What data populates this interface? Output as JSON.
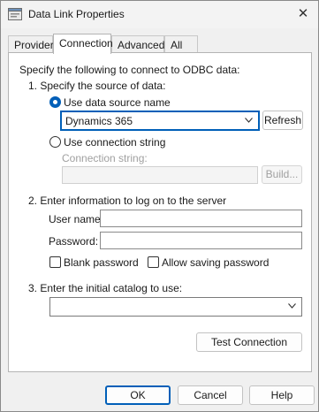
{
  "window": {
    "title": "Data Link Properties",
    "close_glyph": "✕"
  },
  "tabs": [
    {
      "label": "Provider",
      "active": false
    },
    {
      "label": "Connection",
      "active": true
    },
    {
      "label": "Advanced",
      "active": false
    },
    {
      "label": "All",
      "active": false
    }
  ],
  "connection": {
    "intro": "Specify the following to connect to ODBC data:",
    "step1": "1. Specify the source of data:",
    "use_dsn_label": "Use data source name",
    "use_dsn_selected": true,
    "dsn_value": "Dynamics 365",
    "refresh_label": "Refresh",
    "use_connstr_label": "Use connection string",
    "connstr_label": "Connection string:",
    "connstr_value": "",
    "build_label": "Build...",
    "step2": "2. Enter information to log on to the server",
    "username_label": "User name:",
    "username_value": "",
    "password_label": "Password:",
    "password_value": "",
    "blank_password_label": "Blank password",
    "blank_password_checked": false,
    "allow_saving_label": "Allow saving password",
    "allow_saving_checked": false,
    "step3": "3. Enter the initial catalog to use:",
    "catalog_value": "",
    "test_connection_label": "Test Connection"
  },
  "footer": {
    "ok_label": "OK",
    "cancel_label": "Cancel",
    "help_label": "Help"
  },
  "colors": {
    "accent": "#005fb8",
    "panel": "#ffffff",
    "dialog": "#f0f0f0"
  }
}
